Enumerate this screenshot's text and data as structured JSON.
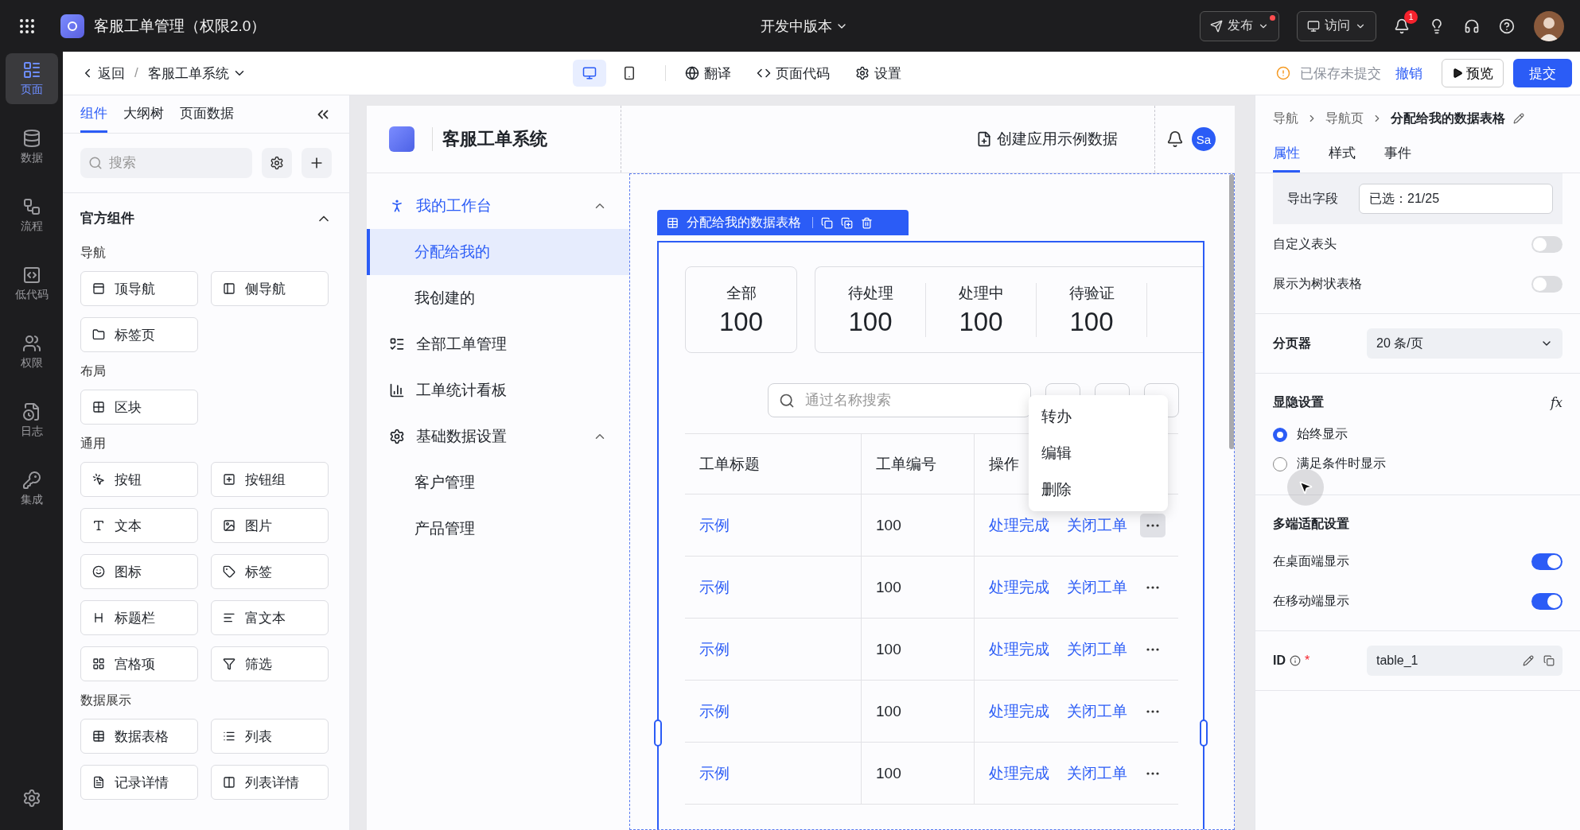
{
  "topbar": {
    "app_title": "客服工单管理（权限2.0）",
    "version": "开发中版本",
    "publish": "发布",
    "visit": "访问",
    "notification_count": "1"
  },
  "rail": [
    {
      "label": "页面",
      "kind": "page",
      "selected": true
    },
    {
      "label": "数据",
      "kind": "data",
      "selected": false
    },
    {
      "label": "流程",
      "kind": "flow",
      "selected": false
    },
    {
      "label": "低代码",
      "kind": "code",
      "selected": false
    },
    {
      "label": "权限",
      "kind": "users",
      "selected": false
    },
    {
      "label": "日志",
      "kind": "log",
      "selected": false
    },
    {
      "label": "集成",
      "kind": "key",
      "selected": false
    }
  ],
  "subheader": {
    "back": "返回",
    "separator": "/",
    "page": "客服工单系统",
    "devices": [
      {
        "kind": "desktop",
        "selected": true
      },
      {
        "kind": "mobile",
        "selected": false
      }
    ],
    "tools": [
      {
        "label": "翻译",
        "kind": "globe"
      },
      {
        "label": "页面代码",
        "kind": "code"
      },
      {
        "label": "设置",
        "kind": "gear"
      }
    ],
    "status": "已保存未提交",
    "undo": "撤销",
    "preview": "预览",
    "submit": "提交"
  },
  "component_panel": {
    "tabs": [
      {
        "label": "组件",
        "selected": true
      },
      {
        "label": "大纲树",
        "selected": false
      },
      {
        "label": "页面数据",
        "selected": false
      }
    ],
    "search_placeholder": "搜索",
    "section_title": "官方组件",
    "expanded": true,
    "groups": [
      {
        "title": "导航",
        "items": [
          {
            "label": "顶导航",
            "kind": "topnav"
          },
          {
            "label": "侧导航",
            "kind": "sidenav"
          },
          {
            "label": "标签页",
            "kind": "folder"
          }
        ]
      },
      {
        "title": "布局",
        "items": [
          {
            "label": "区块",
            "kind": "grid"
          }
        ]
      },
      {
        "title": "通用",
        "items": [
          {
            "label": "按钮",
            "kind": "button"
          },
          {
            "label": "按钮组",
            "kind": "buttongroup"
          },
          {
            "label": "文本",
            "kind": "text"
          },
          {
            "label": "图片",
            "kind": "image"
          },
          {
            "label": "图标",
            "kind": "smile"
          },
          {
            "label": "标签",
            "kind": "tag"
          },
          {
            "label": "标题栏",
            "kind": "heading"
          },
          {
            "label": "富文本",
            "kind": "richtext"
          },
          {
            "label": "宫格项",
            "kind": "tiles"
          },
          {
            "label": "筛选",
            "kind": "filter"
          }
        ]
      },
      {
        "title": "数据展示",
        "items": [
          {
            "label": "数据表格",
            "kind": "table"
          },
          {
            "label": "列表",
            "kind": "list"
          },
          {
            "label": "记录详情",
            "kind": "record"
          },
          {
            "label": "列表详情",
            "kind": "columns"
          }
        ]
      }
    ]
  },
  "canvas": {
    "app_title": "客服工单系统",
    "create_sample": "创建应用示例数据",
    "avatar": "Sa",
    "nav": [
      {
        "label": "我的工作台",
        "kind": "group",
        "selected": false,
        "expanded": true,
        "children": [
          {
            "label": "分配给我的",
            "selected": true
          },
          {
            "label": "我创建的",
            "selected": false
          }
        ]
      },
      {
        "label": "全部工单管理",
        "kind": "item",
        "selected": false
      },
      {
        "label": "工单统计看板",
        "kind": "item",
        "selected": false
      },
      {
        "label": "基础数据设置",
        "kind": "group",
        "selected": false,
        "expanded": true,
        "children": [
          {
            "label": "客户管理",
            "selected": false
          },
          {
            "label": "产品管理",
            "selected": false
          }
        ]
      }
    ],
    "selection_label": "分配给我的数据表格",
    "stat_cards": [
      {
        "stats": [
          {
            "label": "全部",
            "value": "100"
          }
        ]
      },
      {
        "stats": [
          {
            "label": "待处理",
            "value": "100"
          },
          {
            "label": "处理中",
            "value": "100"
          },
          {
            "label": "待验证",
            "value": "100"
          }
        ]
      }
    ],
    "search_placeholder": "通过名称搜索",
    "table": {
      "columns": [
        "工单标题",
        "工单编号",
        "操作"
      ],
      "rows": [
        {
          "title": "示例",
          "number": "100",
          "actions": [
            "处理完成",
            "关闭工单"
          ],
          "menu_open": true
        },
        {
          "title": "示例",
          "number": "100",
          "actions": [
            "处理完成",
            "关闭工单"
          ],
          "menu_open": false
        },
        {
          "title": "示例",
          "number": "100",
          "actions": [
            "处理完成",
            "关闭工单"
          ],
          "menu_open": false
        },
        {
          "title": "示例",
          "number": "100",
          "actions": [
            "处理完成",
            "关闭工单"
          ],
          "menu_open": false
        },
        {
          "title": "示例",
          "number": "100",
          "actions": [
            "处理完成",
            "关闭工单"
          ],
          "menu_open": false
        }
      ]
    },
    "row_menu": [
      "转办",
      "编辑",
      "删除"
    ]
  },
  "properties": {
    "breadcrumb": [
      "导航",
      "导航页",
      "分配给我的数据表格"
    ],
    "tabs": [
      {
        "label": "属性",
        "selected": true
      },
      {
        "label": "样式",
        "selected": false
      },
      {
        "label": "事件",
        "selected": false
      }
    ],
    "export_field": {
      "label": "导出字段",
      "value": "已选：21/25"
    },
    "table_toggles": [
      {
        "label": "自定义表头",
        "on": false
      },
      {
        "label": "展示为树状表格",
        "on": false
      }
    ],
    "pager": {
      "label": "分页器",
      "value": "20 条/页"
    },
    "visibility": {
      "title": "显隐设置",
      "formula": "fx",
      "options": [
        {
          "label": "始终显示",
          "selected": true
        },
        {
          "label": "满足条件时显示",
          "selected": false
        }
      ]
    },
    "multi_device": {
      "title": "多端适配设置",
      "toggles": [
        {
          "label": "在桌面端显示",
          "on": true
        },
        {
          "label": "在移动端显示",
          "on": true
        }
      ]
    },
    "id_field": {
      "label": "ID",
      "required_mark": "*",
      "value": "table_1"
    }
  }
}
